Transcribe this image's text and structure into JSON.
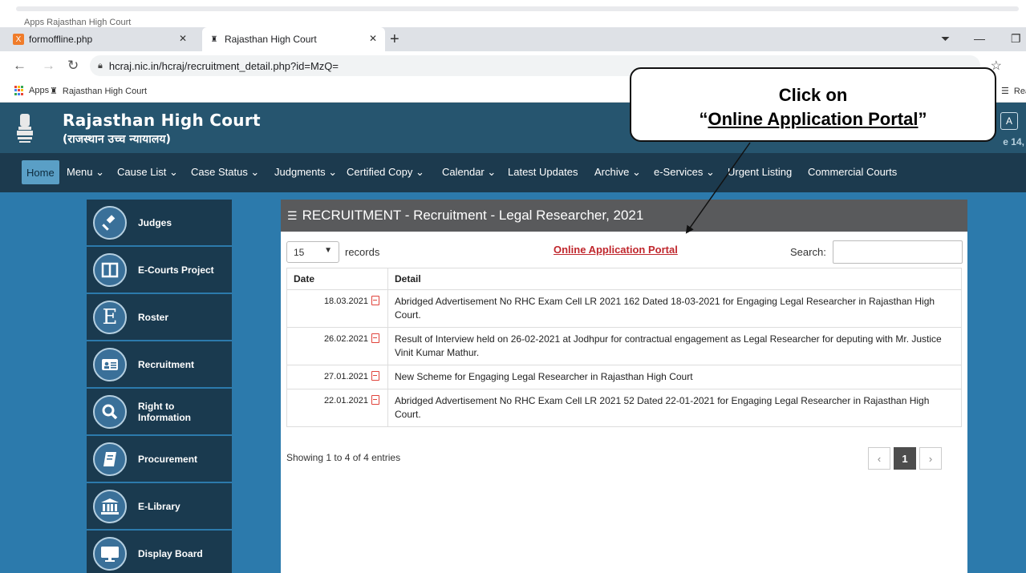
{
  "ghost": {
    "left": "Apps   Rajasthan High Court"
  },
  "tabs": [
    {
      "title": "formoffline.php"
    },
    {
      "title": "Rajasthan High Court"
    }
  ],
  "toolbar": {
    "url": "hcraj.nic.in/hcraj/recruitment_detail.php?id=MzQ="
  },
  "bookmarks": {
    "apps": "Apps",
    "site": "Rajasthan High Court",
    "right": "Rea"
  },
  "header": {
    "title": "Rajasthan High Court",
    "subtitle": "(राजस्थान उच्च न्यायालय)",
    "right_badge": "A",
    "right_text": "e 14,"
  },
  "nav": {
    "home": "Home",
    "items": [
      "Menu ⌄",
      "Cause List ⌄",
      "Case Status ⌄",
      "Judgments ⌄",
      "Certified Copy ⌄",
      "Calendar ⌄",
      "Latest Updates",
      "Archive ⌄",
      "e-Services ⌄",
      "Urgent Listing",
      "Commercial Courts"
    ]
  },
  "sidebar": [
    {
      "label": "Judges",
      "icon": "gavel-icon"
    },
    {
      "label": "E-Courts Project",
      "icon": "columns-icon"
    },
    {
      "label": "Roster",
      "icon": "letter-e-icon"
    },
    {
      "label": "Recruitment",
      "icon": "id-card-icon"
    },
    {
      "label": "Right to Information",
      "icon": "search-icon"
    },
    {
      "label": "Procurement",
      "icon": "book-icon"
    },
    {
      "label": "E-Library",
      "icon": "institution-icon"
    },
    {
      "label": "Display Board",
      "icon": "monitor-icon"
    }
  ],
  "panel": {
    "heading": "RECRUITMENT - Recruitment - Legal Researcher, 2021",
    "length_value": "15",
    "length_suffix": "records",
    "portal_link": "Online Application Portal",
    "search_label": "Search:",
    "columns": [
      "Date",
      "Detail"
    ],
    "rows": [
      {
        "date": "18.03.2021",
        "detail": "Abridged Advertisement No RHC Exam Cell LR 2021 162 Dated 18-03-2021 for Engaging Legal Researcher in Rajasthan High Court."
      },
      {
        "date": "26.02.2021",
        "detail": "Result of Interview held on 26-02-2021 at Jodhpur for contractual engagement as Legal Researcher for deputing with Mr. Justice Vinit Kumar Mathur."
      },
      {
        "date": "27.01.2021",
        "detail": "New Scheme for Engaging Legal Researcher in Rajasthan High Court"
      },
      {
        "date": "22.01.2021",
        "detail": "Abridged Advertisement No RHC Exam Cell LR 2021 52 Dated 22-01-2021 for Engaging Legal Researcher in Rajasthan High Court."
      }
    ],
    "showing": "Showing 1 to 4 of 4 entries",
    "pager": {
      "prev": "‹",
      "current": "1",
      "next": "›"
    }
  },
  "callout": {
    "line1": "Click on",
    "open_quote": "“",
    "link": "Online Application Portal",
    "close_quote": "”"
  },
  "colors": {
    "header_bg": "#26556f",
    "nav_bg": "#1c3a4e",
    "page_bg": "#2c7aac",
    "link_red": "#c0272d"
  }
}
